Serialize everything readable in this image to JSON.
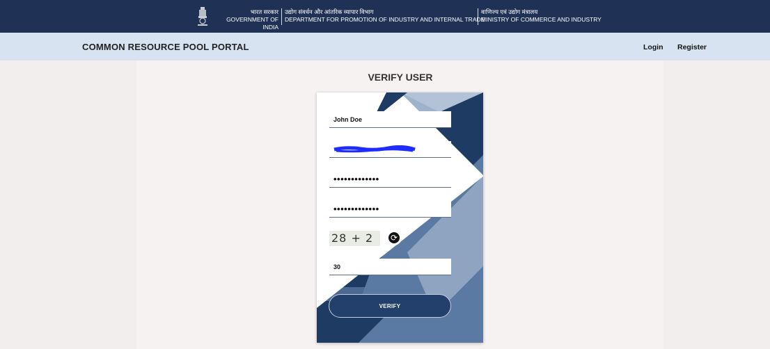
{
  "gov_bar": {
    "hindi_gov": "भारत सरकार",
    "gov_of_india": "GOVERNMENT OF INDIA",
    "hindi_dept": "उद्योग संवर्धन और आंतरिक व्यापार विभाग",
    "dept": "DEPARTMENT FOR PROMOTION OF INDUSTRY AND INTERNAL TRADE",
    "hindi_ministry": "वाणिज्य एवं उद्योग मंत्रालय",
    "ministry": "MINISTRY OF COMMERCE AND INDUSTRY",
    "emblem_icon": "national-emblem-icon"
  },
  "nav": {
    "title": "COMMON RESOURCE POOL PORTAL",
    "login": "Login",
    "register": "Register"
  },
  "page": {
    "heading": "VERIFY USER"
  },
  "form": {
    "name_value": "John Doe",
    "password_value": "•••••••••••••",
    "confirm_password_value": "•••••••••••••",
    "captcha_text": "28 + 2 =",
    "captcha_answer": "30",
    "refresh_icon": "refresh-icon",
    "verify_label": "VERIFY"
  },
  "colors": {
    "gov_bar": "#1f3256",
    "nav_bar": "#d7e3f0",
    "card_dark": "#1e3b63",
    "card_light": "#8ea4c0",
    "scribble": "#1f2cff"
  }
}
